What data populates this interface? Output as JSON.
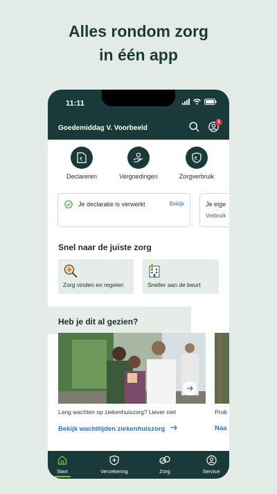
{
  "headline": {
    "line1": "Alles rondom zorg",
    "line2": "in één app"
  },
  "status_bar": {
    "time": "11:11"
  },
  "header": {
    "greeting": "Goedemiddag V. Voorbeeld",
    "notification_count": "1"
  },
  "quick_actions": [
    {
      "label": "Declareren",
      "icon": "declaration-icon"
    },
    {
      "label": "Vergoedingen",
      "icon": "coverage-icon"
    },
    {
      "label": "Zorgverbruik",
      "icon": "care-usage-icon"
    }
  ],
  "cards": [
    {
      "message": "Je declaratie is verwerkt",
      "link": "Bekijk"
    },
    {
      "message": "Je eige",
      "sub": "Verbruik"
    }
  ],
  "snel": {
    "title": "Snel naar de juiste zorg",
    "tiles": [
      {
        "label": "Zorg vinden en regelen"
      },
      {
        "label": "Sneller aan de beurt"
      }
    ]
  },
  "gezien": {
    "title": "Heb je dit al gezien?",
    "items": [
      {
        "caption": "Lang wachten op ziekenhuiszorg? Liever niet",
        "link": "Bekijk wachttijden ziekenhuiszorg"
      },
      {
        "caption": "Prob",
        "link": "Naa"
      }
    ]
  },
  "tabs": [
    {
      "label": "Start",
      "active": true
    },
    {
      "label": "Verzekering"
    },
    {
      "label": "Zorg"
    },
    {
      "label": "Service"
    }
  ],
  "colors": {
    "dark": "#1a3a3a",
    "accent_green": "#7dc242",
    "link_blue": "#2a6fdb",
    "badge_red": "#d6333a"
  }
}
